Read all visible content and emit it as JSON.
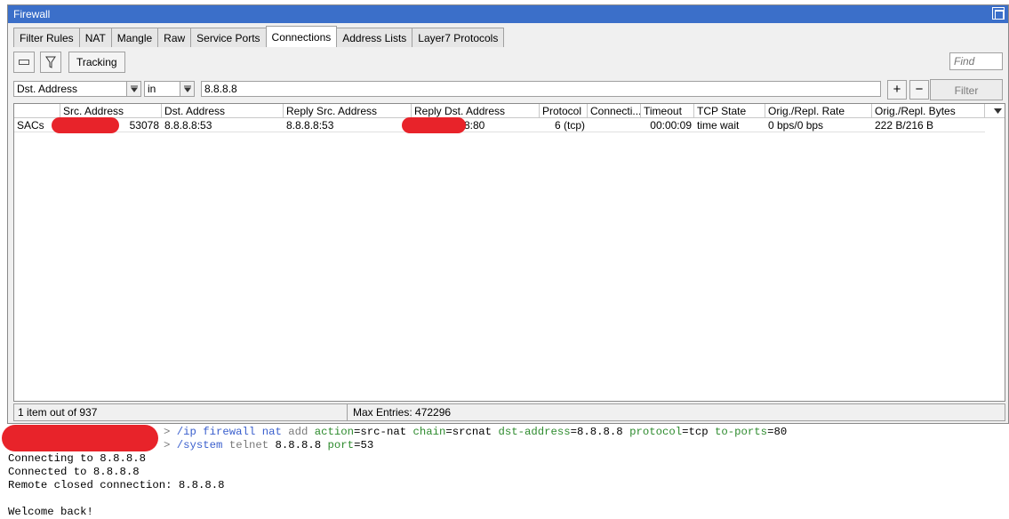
{
  "window": {
    "title": "Firewall"
  },
  "tabs": [
    "Filter Rules",
    "NAT",
    "Mangle",
    "Raw",
    "Service Ports",
    "Connections",
    "Address Lists",
    "Layer7 Protocols"
  ],
  "toolbar": {
    "tracking_label": "Tracking",
    "find_placeholder": "Find"
  },
  "filter": {
    "field": "Dst. Address",
    "operator": "in",
    "value": "8.8.8.8",
    "add_label": "+",
    "remove_label": "−",
    "filter_label": "Filter"
  },
  "table": {
    "columns": [
      "Src. Address",
      "Dst. Address",
      "Reply Src. Address",
      "Reply Dst. Address",
      "Protocol",
      "Connecti...",
      "Timeout",
      "TCP State",
      "Orig./Repl. Rate",
      "Orig./Repl. Bytes"
    ],
    "rows": [
      {
        "flags": "SACs",
        "src_address": "53078",
        "dst_address": "8.8.8.8:53",
        "reply_src_address": "8.8.8.8:53",
        "reply_dst_address": "8:80",
        "protocol": "6 (tcp)",
        "connection": "",
        "timeout": "00:00:09",
        "tcp_state": "time wait",
        "rate": "0 bps/0 bps",
        "bytes": "222 B/216 B"
      }
    ]
  },
  "status": {
    "count": "1 item out of 937",
    "max_entries": "Max Entries: 472296"
  },
  "terminal": {
    "cmd1": {
      "prompt": "> ",
      "path": "/ip firewall nat",
      "verb": "add",
      "args": [
        {
          "key": "action",
          "value": "src-nat"
        },
        {
          "key": "chain",
          "value": "srcnat"
        },
        {
          "key": "dst-address",
          "value": "8.8.8.8"
        },
        {
          "key": "protocol",
          "value": "tcp"
        },
        {
          "key": "to-ports",
          "value": "80"
        }
      ]
    },
    "cmd2": {
      "prompt": "> ",
      "path": "/system",
      "verb": "telnet",
      "args": [
        {
          "key": "",
          "value": "8.8.8.8"
        },
        {
          "key": "port",
          "value": "53"
        }
      ]
    },
    "output": [
      "Connecting to 8.8.8.8",
      "Connected to 8.8.8.8",
      "Remote closed connection: 8.8.8.8",
      "",
      "Welcome back!"
    ]
  },
  "colors": {
    "titlebar": "#3b6fc9",
    "redaction": "#e8232a",
    "cmd_path": "#3a5fcd",
    "cmd_param": "#2e8b2e"
  }
}
